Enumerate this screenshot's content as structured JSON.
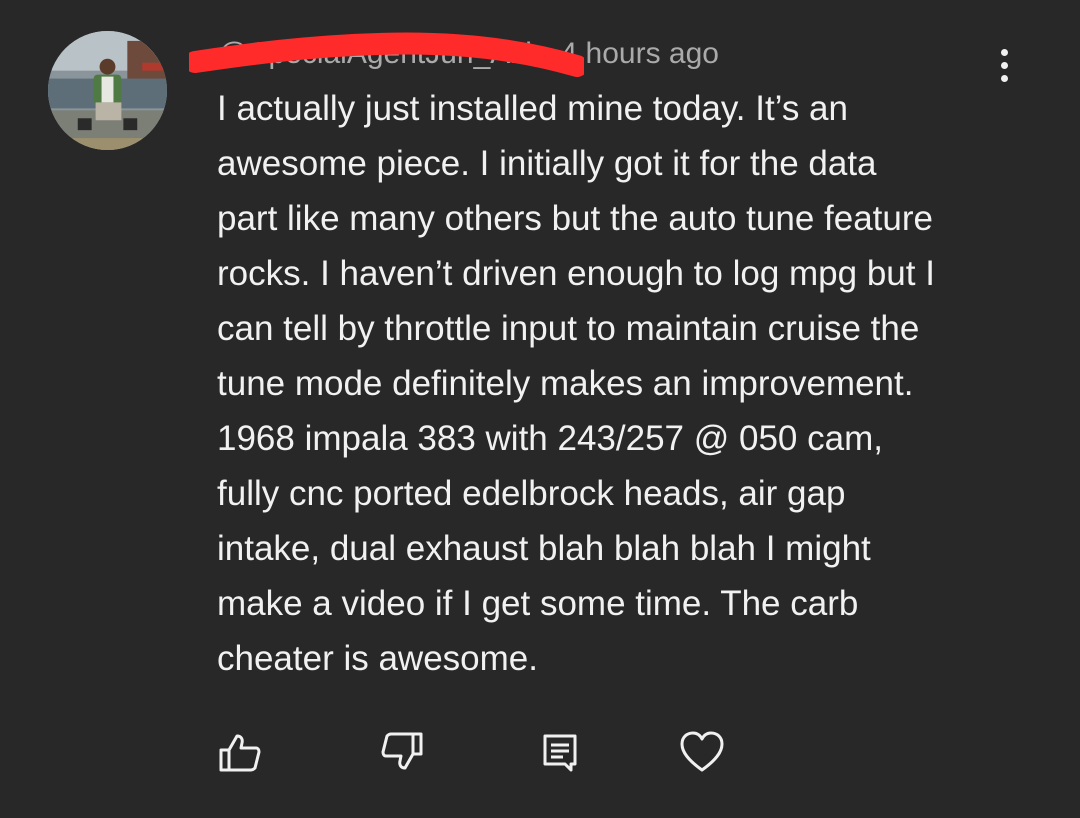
{
  "comment": {
    "author_handle": "@SpecialAgentJun_Aki",
    "separator": "•",
    "timestamp": "4 hours ago",
    "avatar_icon": "user-avatar-photo",
    "menu_icon": "more-vertical-icon",
    "redaction_color": "#ff2a2a",
    "body_lines": [
      "I actually just installed mine today. It’s an",
      "awesome piece. I initially got it for the data",
      "part like many others but the auto tune feature",
      "rocks. I haven’t driven enough to log mpg but I",
      "can tell by throttle input to maintain cruise the",
      "tune mode definitely makes an improvement.",
      "1968 impala 383 with 243/257 @ 050 cam,",
      "fully cnc ported edelbrock heads, air gap",
      "intake, dual exhaust blah blah blah I might",
      "make a video if I get some time. The carb",
      "cheater is awesome."
    ]
  },
  "actions": {
    "like_icon": "thumbs-up-icon",
    "dislike_icon": "thumbs-down-icon",
    "reply_icon": "reply-comment-icon",
    "heart_icon": "heart-icon"
  },
  "theme": {
    "background": "#282828",
    "text_primary": "#f1f1f1",
    "text_secondary": "#aaaaaa"
  }
}
